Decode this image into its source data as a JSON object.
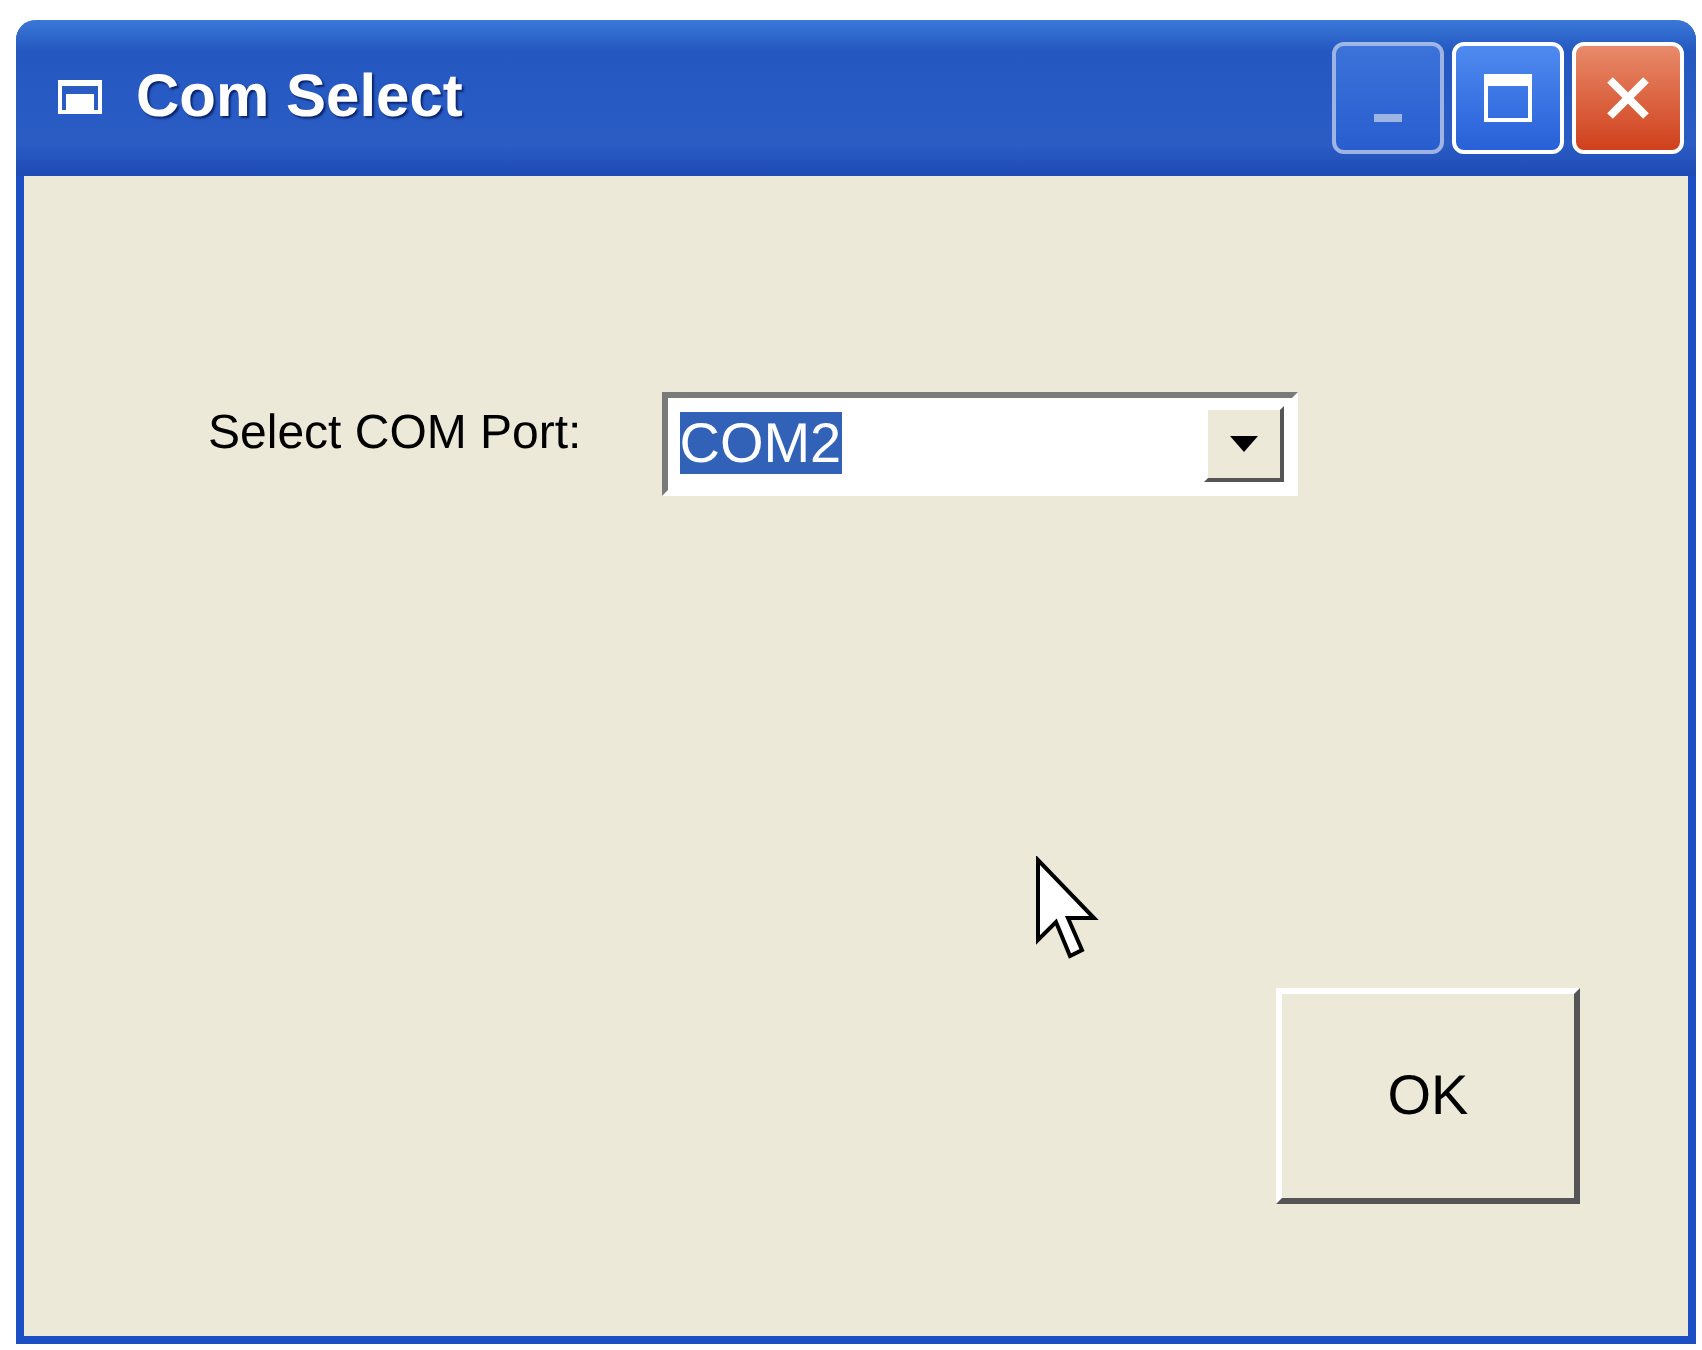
{
  "window": {
    "title": "Com Select"
  },
  "title_buttons": [
    {
      "kind": "minimize",
      "disabled": true
    },
    {
      "kind": "maximize",
      "disabled": false
    },
    {
      "kind": "close",
      "disabled": false
    }
  ],
  "port_label": "Select COM Port:",
  "port_combo": {
    "value": "COM2",
    "highlighted": true
  },
  "buttons": [
    "OK"
  ]
}
